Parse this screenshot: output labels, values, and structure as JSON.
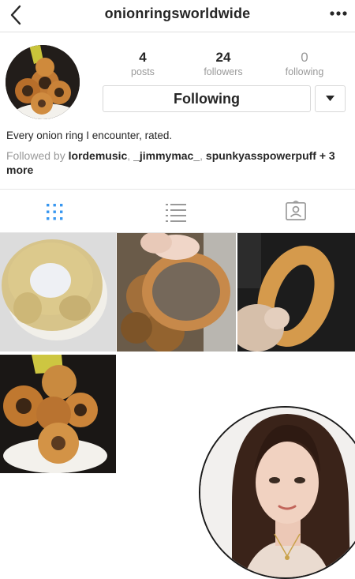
{
  "header": {
    "username": "onionringsworldwide",
    "back_icon": "chevron-left-icon",
    "more_icon": "ellipsis-icon"
  },
  "profile": {
    "stats": [
      {
        "count": "4",
        "label": "posts"
      },
      {
        "count": "24",
        "label": "followers"
      },
      {
        "count": "0",
        "label": "following"
      }
    ],
    "follow_button": "Following",
    "bio": "Every onion ring I encounter, rated.",
    "followed_by_prefix": "Followed by",
    "followed_by_users": [
      "lordemusic",
      "_jimmymac_",
      "spunkyasspowerpuff"
    ],
    "followed_by_more": "+ 3 more"
  },
  "tabs": [
    {
      "name": "grid-view",
      "icon": "grid-icon",
      "active": true
    },
    {
      "name": "list-view",
      "icon": "list-icon",
      "active": false
    },
    {
      "name": "tagged-view",
      "icon": "tagged-icon",
      "active": false
    }
  ],
  "colors": {
    "accent": "#3897f0",
    "muted": "#999999",
    "text": "#262626"
  }
}
